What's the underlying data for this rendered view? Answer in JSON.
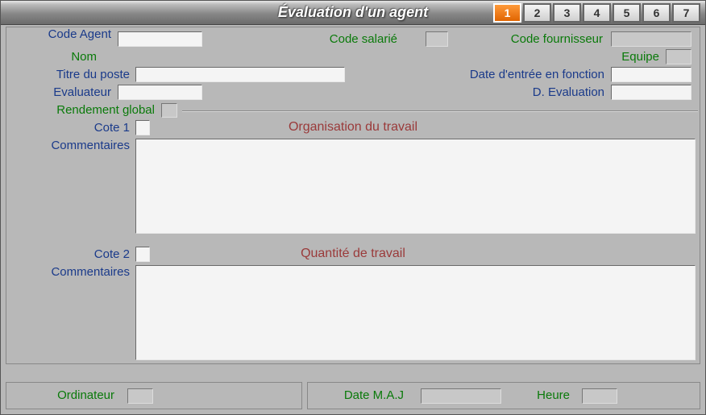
{
  "window": {
    "title": "Évaluation d'un agent"
  },
  "tabs": [
    "1",
    "2",
    "3",
    "4",
    "5",
    "6",
    "7"
  ],
  "active_tab": 0,
  "labels": {
    "code_agent": "Code Agent",
    "nom": "Nom",
    "code_salarie": "Code salarié",
    "code_fournisseur": "Code fournisseur",
    "equipe": "Equipe",
    "titre_poste": "Titre du poste",
    "date_entree": "Date d'entrée en fonction",
    "evaluateur": "Evaluateur",
    "d_evaluation": "D. Evaluation",
    "rendement_global": "Rendement global",
    "cote1": "Cote 1",
    "commentaires1": "Commentaires",
    "section1_title": "Organisation du travail",
    "cote2": "Cote 2",
    "commentaires2": "Commentaires",
    "section2_title": "Quantité de travail",
    "ordinateur": "Ordinateur",
    "date_maj": "Date M.A.J",
    "heure": "Heure"
  },
  "values": {
    "code_agent": "",
    "nom": "",
    "code_salarie": "",
    "code_fournisseur": "",
    "equipe": "",
    "titre_poste": "",
    "date_entree": "",
    "evaluateur": "",
    "d_evaluation": "",
    "rendement_global": "",
    "cote1": "",
    "commentaires1": "",
    "cote2": "",
    "commentaires2": "",
    "ordinateur": "",
    "date_maj": "",
    "heure": ""
  }
}
